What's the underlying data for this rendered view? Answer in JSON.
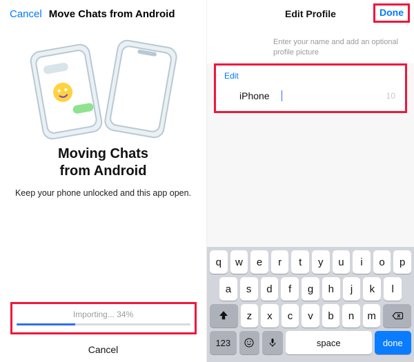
{
  "left": {
    "cancel_top": "Cancel",
    "header_title": "Move Chats from Android",
    "heading_line1": "Moving Chats",
    "heading_line2": "from Android",
    "instruction": "Keep your phone unlocked and this app open.",
    "progress_label": "Importing... 34%",
    "progress_percent": 34,
    "cancel_bottom": "Cancel"
  },
  "right": {
    "title": "Edit Profile",
    "done": "Done",
    "hint": "Enter your name and add an optional profile picture",
    "edit_label": "Edit",
    "name_value": "iPhone",
    "name_remaining": "10"
  },
  "keyboard": {
    "row1": [
      "q",
      "w",
      "e",
      "r",
      "t",
      "y",
      "u",
      "i",
      "o",
      "p"
    ],
    "row2": [
      "a",
      "s",
      "d",
      "f",
      "g",
      "h",
      "j",
      "k",
      "l"
    ],
    "row3_mid": [
      "z",
      "x",
      "c",
      "v",
      "b",
      "n",
      "m"
    ],
    "num_key": "123",
    "space": "space",
    "done": "done"
  }
}
